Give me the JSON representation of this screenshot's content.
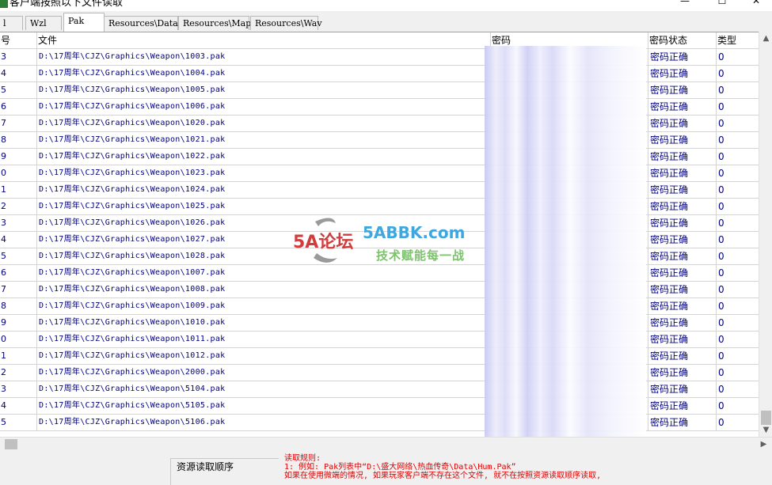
{
  "window": {
    "title": "客户端按照以下文件读取",
    "controls": {
      "minimize": "—",
      "maximize": "☐",
      "close": "✕"
    }
  },
  "tabs": [
    {
      "label": "l",
      "active": false
    },
    {
      "label": "Wzl",
      "active": false
    },
    {
      "label": "Pak",
      "active": true
    },
    {
      "label": "Resources\\Data",
      "active": false
    },
    {
      "label": "Resources\\Map",
      "active": false
    },
    {
      "label": "Resources\\Wav",
      "active": false
    }
  ],
  "table": {
    "columns": [
      "号",
      "文件",
      "密码",
      "密码状态",
      "类型"
    ],
    "rows": [
      {
        "no": "3",
        "file": "D:\\17周年\\CJZ\\Graphics\\Weapon\\1003.pak",
        "status": "密码正确",
        "type": "0"
      },
      {
        "no": "4",
        "file": "D:\\17周年\\CJZ\\Graphics\\Weapon\\1004.pak",
        "status": "密码正确",
        "type": "0"
      },
      {
        "no": "5",
        "file": "D:\\17周年\\CJZ\\Graphics\\Weapon\\1005.pak",
        "status": "密码正确",
        "type": "0"
      },
      {
        "no": "6",
        "file": "D:\\17周年\\CJZ\\Graphics\\Weapon\\1006.pak",
        "status": "密码正确",
        "type": "0"
      },
      {
        "no": "7",
        "file": "D:\\17周年\\CJZ\\Graphics\\Weapon\\1020.pak",
        "status": "密码正确",
        "type": "0"
      },
      {
        "no": "8",
        "file": "D:\\17周年\\CJZ\\Graphics\\Weapon\\1021.pak",
        "status": "密码正确",
        "type": "0"
      },
      {
        "no": "9",
        "file": "D:\\17周年\\CJZ\\Graphics\\Weapon\\1022.pak",
        "status": "密码正确",
        "type": "0"
      },
      {
        "no": "0",
        "file": "D:\\17周年\\CJZ\\Graphics\\Weapon\\1023.pak",
        "status": "密码正确",
        "type": "0"
      },
      {
        "no": "1",
        "file": "D:\\17周年\\CJZ\\Graphics\\Weapon\\1024.pak",
        "status": "密码正确",
        "type": "0"
      },
      {
        "no": "2",
        "file": "D:\\17周年\\CJZ\\Graphics\\Weapon\\1025.pak",
        "status": "密码正确",
        "type": "0"
      },
      {
        "no": "3",
        "file": "D:\\17周年\\CJZ\\Graphics\\Weapon\\1026.pak",
        "status": "密码正确",
        "type": "0"
      },
      {
        "no": "4",
        "file": "D:\\17周年\\CJZ\\Graphics\\Weapon\\1027.pak",
        "status": "密码正确",
        "type": "0"
      },
      {
        "no": "5",
        "file": "D:\\17周年\\CJZ\\Graphics\\Weapon\\1028.pak",
        "status": "密码正确",
        "type": "0"
      },
      {
        "no": "6",
        "file": "D:\\17周年\\CJZ\\Graphics\\Weapon\\1007.pak",
        "status": "密码正确",
        "type": "0"
      },
      {
        "no": "7",
        "file": "D:\\17周年\\CJZ\\Graphics\\Weapon\\1008.pak",
        "status": "密码正确",
        "type": "0"
      },
      {
        "no": "8",
        "file": "D:\\17周年\\CJZ\\Graphics\\Weapon\\1009.pak",
        "status": "密码正确",
        "type": "0"
      },
      {
        "no": "9",
        "file": "D:\\17周年\\CJZ\\Graphics\\Weapon\\1010.pak",
        "status": "密码正确",
        "type": "0"
      },
      {
        "no": "0",
        "file": "D:\\17周年\\CJZ\\Graphics\\Weapon\\1011.pak",
        "status": "密码正确",
        "type": "0"
      },
      {
        "no": "1",
        "file": "D:\\17周年\\CJZ\\Graphics\\Weapon\\1012.pak",
        "status": "密码正确",
        "type": "0"
      },
      {
        "no": "2",
        "file": "D:\\17周年\\CJZ\\Graphics\\Weapon\\2000.pak",
        "status": "密码正确",
        "type": "0"
      },
      {
        "no": "3",
        "file": "D:\\17周年\\CJZ\\Graphics\\Weapon\\5104.pak",
        "status": "密码正确",
        "type": "0"
      },
      {
        "no": "4",
        "file": "D:\\17周年\\CJZ\\Graphics\\Weapon\\5105.pak",
        "status": "密码正确",
        "type": "0"
      },
      {
        "no": "5",
        "file": "D:\\17周年\\CJZ\\Graphics\\Weapon\\5106.pak",
        "status": "密码正确",
        "type": "0"
      }
    ]
  },
  "bottom": {
    "order_label": "资源读取顺序",
    "rules": [
      "读取规则:",
      "1: 例如: Pak列表中“D:\\盛大网络\\热血传奇\\Data\\Hum.Pak”",
      "   如果在使用微端的情况, 如果玩家客户端不存在这个文件, 就不在按照资源读取顺序读取,"
    ]
  },
  "watermark": {
    "logo": "5A论坛",
    "site": "5ABBK.com",
    "slogan": "技术赋能每一战"
  },
  "colors": {
    "row_text": "#000080",
    "rules_text": "#e00000",
    "grid_line": "#d4d4d4",
    "blur_tint": "#c8c8f4"
  }
}
